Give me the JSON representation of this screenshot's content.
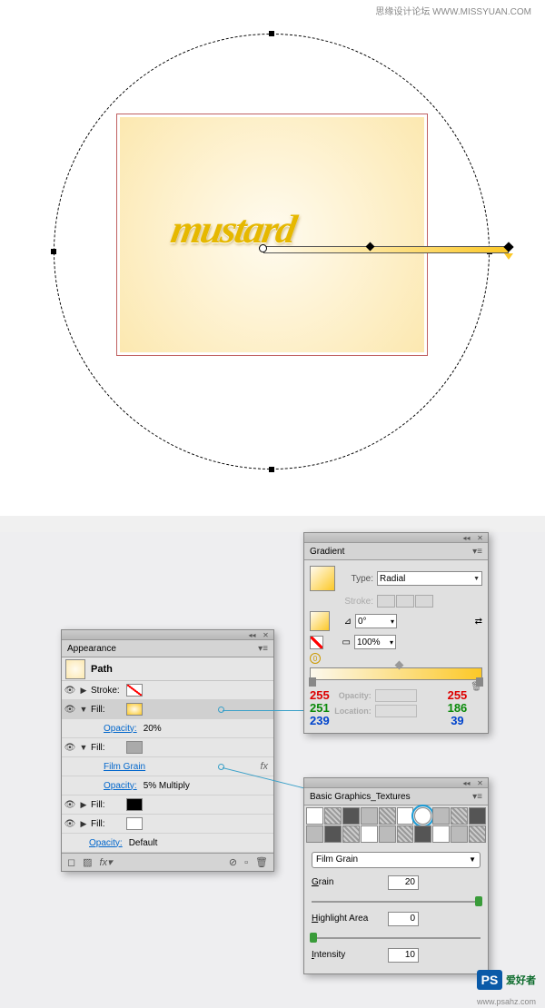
{
  "watermark_top": "思缘设计论坛  WWW.MISSYUAN.COM",
  "artwork_text": "mustard",
  "appearance": {
    "title": "Appearance",
    "path_label": "Path",
    "stroke_label": "Stroke:",
    "fill_label": "Fill:",
    "opacity_label": "Opacity:",
    "film_grain": "Film Grain",
    "opacity_20": "20%",
    "opacity_5_multiply": "5% Multiply",
    "opacity_default": "Default",
    "fx": "fx"
  },
  "gradient": {
    "title": "Gradient",
    "type_label": "Type:",
    "type_value": "Radial",
    "stroke_label": "Stroke:",
    "angle_value": "0°",
    "ratio_value": "100%",
    "opacity_label": "Opacity:",
    "location_label": "Location:",
    "color_left": {
      "r": "255",
      "g": "251",
      "b": "239"
    },
    "color_right": {
      "r": "255",
      "g": "186",
      "b": "39"
    }
  },
  "textures": {
    "title": "Basic Graphics_Textures",
    "select_value": "Film Grain",
    "grain_label": "Grain",
    "grain_value": "20",
    "highlight_label": "Highlight Area",
    "highlight_value": "0",
    "intensity_label": "Intensity",
    "intensity_value": "10"
  },
  "watermark_bottom": {
    "logo": "PS",
    "text": "爱好者",
    "url": "www.psahz.com"
  },
  "chart_data": null
}
